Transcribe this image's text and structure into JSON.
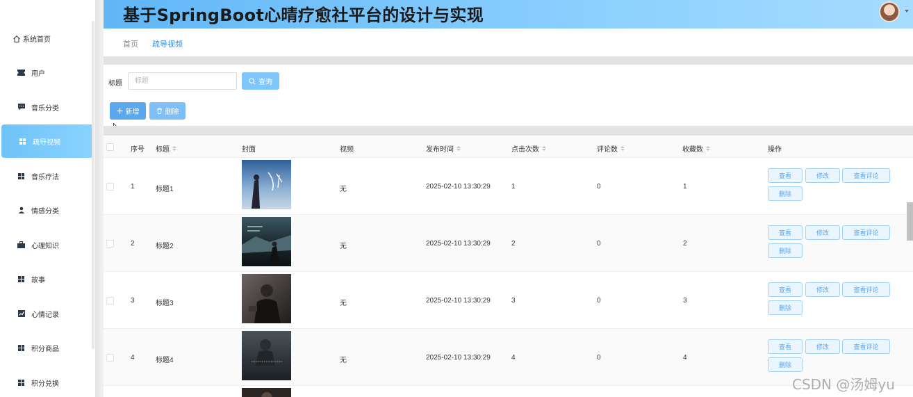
{
  "header": {
    "title": "基于SpringBoot心晴疗愈社平台的设计与实现"
  },
  "sidebar": {
    "home_label": "系统首页",
    "items": [
      {
        "label": "用户",
        "icon": "ticket-icon"
      },
      {
        "label": "音乐分类",
        "icon": "comment-icon"
      },
      {
        "label": "疏导视频",
        "icon": "grid-icon",
        "active": true
      },
      {
        "label": "音乐疗法",
        "icon": "grid-icon"
      },
      {
        "label": "情感分类",
        "icon": "user-icon"
      },
      {
        "label": "心理知识",
        "icon": "briefcase-icon"
      },
      {
        "label": "故事",
        "icon": "grid-icon"
      },
      {
        "label": "心情记录",
        "icon": "chart-icon"
      },
      {
        "label": "积分商品",
        "icon": "grid-icon"
      },
      {
        "label": "积分兑换",
        "icon": "grid-icon"
      }
    ]
  },
  "breadcrumb": {
    "home": "首页",
    "current": "疏导视频"
  },
  "search": {
    "label": "标题",
    "placeholder": "标题",
    "value": "",
    "button": "查询"
  },
  "toolbar": {
    "add": "新增",
    "delete": "删除"
  },
  "table": {
    "columns": [
      "序号",
      "标题",
      "封面",
      "视频",
      "发布时间",
      "点击次数",
      "评论数",
      "收藏数",
      "操作"
    ],
    "rows": [
      {
        "index": "1",
        "title": "标题1",
        "video": "无",
        "time": "2025-02-10 13:30:29",
        "clicks": "1",
        "comments": "0",
        "favorites": "1"
      },
      {
        "index": "2",
        "title": "标题2",
        "video": "无",
        "time": "2025-02-10 13:30:29",
        "clicks": "2",
        "comments": "0",
        "favorites": "2"
      },
      {
        "index": "3",
        "title": "标题3",
        "video": "无",
        "time": "2025-02-10 13:30:29",
        "clicks": "3",
        "comments": "0",
        "favorites": "3"
      },
      {
        "index": "4",
        "title": "标题4",
        "video": "无",
        "time": "2025-02-10 13:30:29",
        "clicks": "4",
        "comments": "0",
        "favorites": "4"
      }
    ],
    "actions": {
      "view": "查看",
      "edit": "修改",
      "view_comments": "查看评论",
      "delete": "删除"
    }
  },
  "watermark": "CSDN @汤姆yu",
  "colors": {
    "accent": "#5aa8ee",
    "active_nav": "#6ec3f8",
    "header_gradient_start": "#61b6f6"
  }
}
